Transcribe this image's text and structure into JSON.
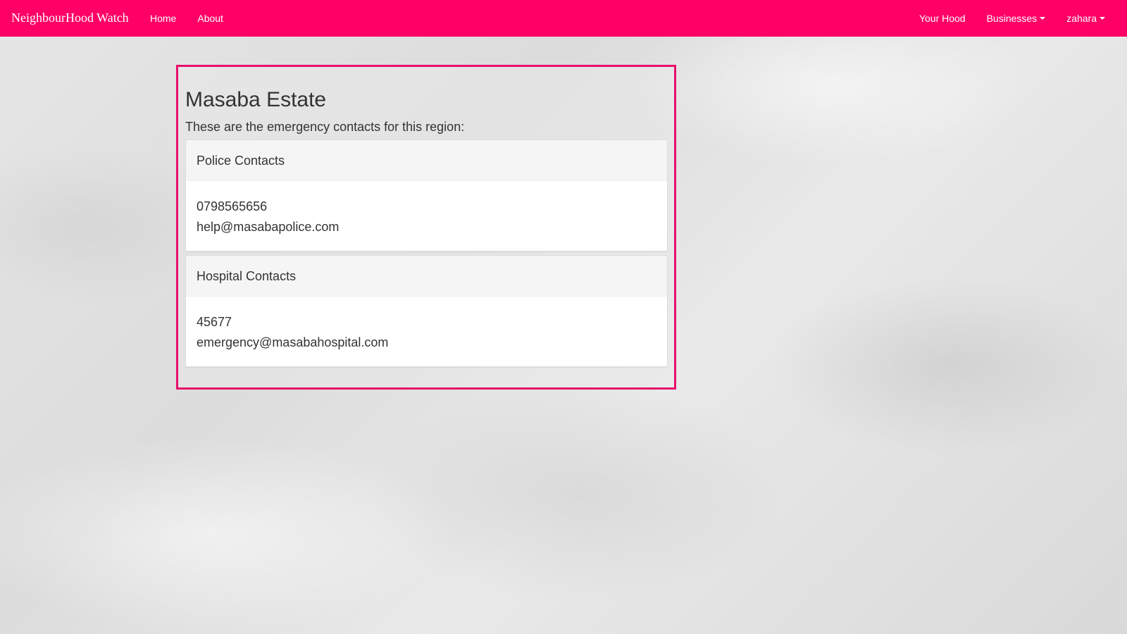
{
  "navbar": {
    "brand": "NeighbourHood Watch",
    "left_links": [
      "Home",
      "About"
    ],
    "right_links": {
      "your_hood": "Your Hood",
      "businesses": "Businesses",
      "user": "zahara"
    },
    "background_color": "#ff0066"
  },
  "region": {
    "title": "Masaba Estate",
    "subtitle": "These are the emergency contacts for this region:",
    "border_color": "#e8106b",
    "panels": [
      {
        "heading": "Police Contacts",
        "phone": "0798565656",
        "email": "help@masabapolice.com"
      },
      {
        "heading": "Hospital Contacts",
        "phone": "45677",
        "email": "emergency@masabahospital.com"
      }
    ]
  },
  "icons": {
    "dropdown": "caret-down-icon"
  }
}
